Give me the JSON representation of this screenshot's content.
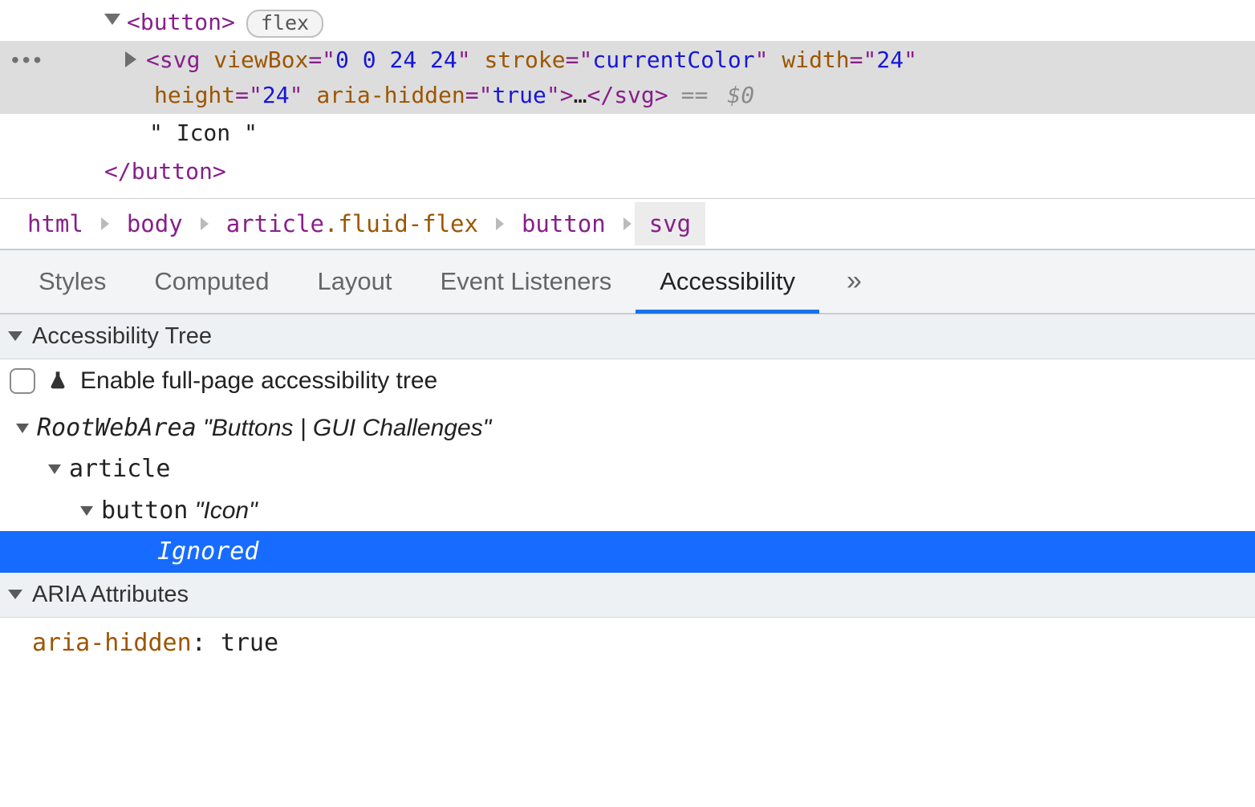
{
  "dom": {
    "button_open": "button",
    "flex_badge": "flex",
    "svg": {
      "tag": "svg",
      "attrs": [
        {
          "name": "viewBox",
          "value": "0 0 24 24"
        },
        {
          "name": "stroke",
          "value": "currentColor"
        },
        {
          "name": "width",
          "value": "24"
        },
        {
          "name": "height",
          "value": "24"
        },
        {
          "name": "aria-hidden",
          "value": "true"
        }
      ],
      "ellipsis": "…",
      "close": "svg"
    },
    "selected_marker": "== $0",
    "text_node": "\" Icon \"",
    "button_close": "button"
  },
  "actions_ellipsis": "•••",
  "breadcrumb": [
    {
      "label": "html",
      "cls": ""
    },
    {
      "label": "body",
      "cls": ""
    },
    {
      "label": "article",
      "cls": ".fluid-flex"
    },
    {
      "label": "button",
      "cls": ""
    },
    {
      "label": "svg",
      "cls": "",
      "selected": true
    }
  ],
  "tabs": {
    "items": [
      "Styles",
      "Computed",
      "Layout",
      "Event Listeners",
      "Accessibility"
    ],
    "active": "Accessibility",
    "overflow": "»"
  },
  "a11y": {
    "tree_section": "Accessibility Tree",
    "enable_fullpage": "Enable full-page accessibility tree",
    "tree": {
      "root_role": "RootWebArea",
      "root_name": "Buttons | GUI Challenges",
      "l1_role": "article",
      "l2_role": "button",
      "l2_name": "Icon",
      "l3_ignored": "Ignored"
    },
    "aria_section": "ARIA Attributes",
    "aria_attr_key": "aria-hidden",
    "aria_attr_val": "true"
  }
}
